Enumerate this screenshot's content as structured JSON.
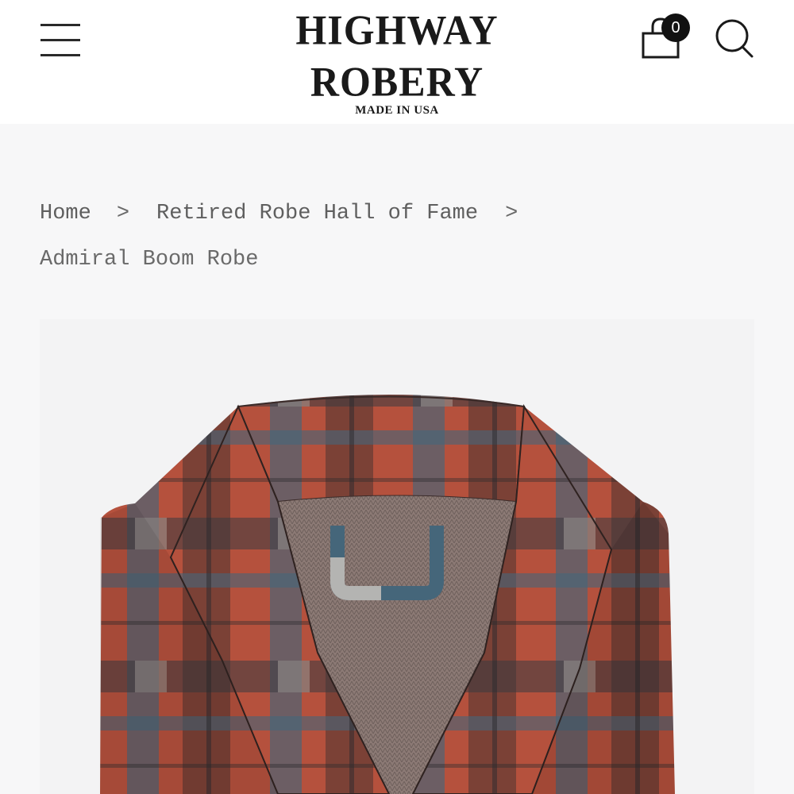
{
  "header": {
    "logo_title": "HIGHWAY ROBERY",
    "logo_tagline": "MADE IN USA",
    "cart_count": "0",
    "icons": {
      "menu": "menu-icon",
      "cart": "cart-icon",
      "search": "search-icon"
    }
  },
  "breadcrumb": {
    "home": "Home",
    "separator": ">",
    "category": "Retired Robe Hall of Fame",
    "current": "Admiral Boom Robe"
  },
  "product": {
    "image_colors": {
      "rust": "#b5513d",
      "dark_brown": "#4a3330",
      "slate_blue": "#45667a",
      "charcoal": "#3b3b3f",
      "light_gray": "#cfc8c0",
      "lining": "#8c7a75",
      "background": "#f3f3f4"
    }
  }
}
